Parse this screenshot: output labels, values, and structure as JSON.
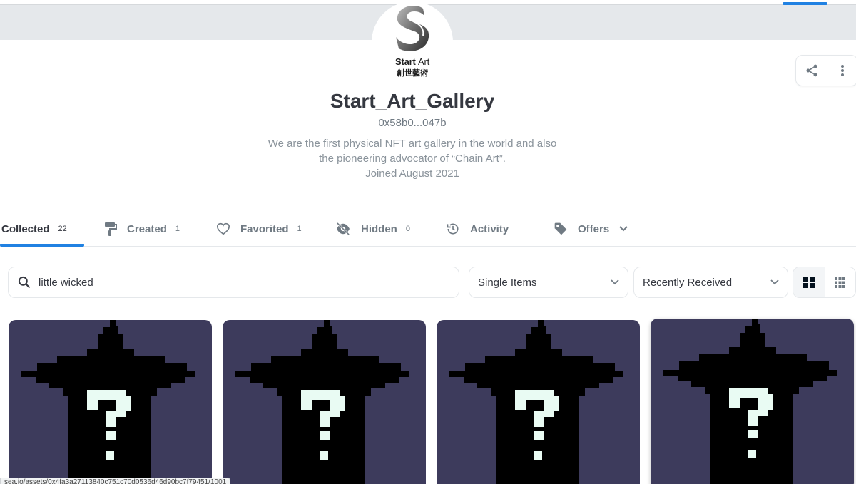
{
  "profile": {
    "logo_text_start": "Start",
    "logo_text_art": "Art",
    "logo_text_cn": "創世藝術",
    "name": "Start_Art_Gallery",
    "wallet": "0x58b0...047b",
    "bio_line1": "We are the first physical NFT art gallery in the world and also",
    "bio_line2": "the pioneering advocator of “Chain Art”.",
    "joined": "Joined August 2021"
  },
  "actions": {
    "share_icon": "share-icon",
    "more_icon": "more-vertical-icon"
  },
  "tabs": [
    {
      "label": "Collected",
      "count": "22",
      "active": true
    },
    {
      "label": "Created",
      "count": "1",
      "icon": "paint-roller-icon"
    },
    {
      "label": "Favorited",
      "count": "1",
      "icon": "heart-icon"
    },
    {
      "label": "Hidden",
      "count": "0",
      "icon": "eye-off-icon"
    },
    {
      "label": "Activity",
      "icon": "history-icon"
    },
    {
      "label": "Offers",
      "icon": "tag-icon"
    }
  ],
  "filters": {
    "search_value": "little wicked",
    "item_type": "Single Items",
    "sort": "Recently Received"
  },
  "cards_count_visible": 4,
  "status_url": "sea.io/assets/0x4fa3a27113840c751c70d0536d46d90bc7f79451/1001",
  "colors": {
    "accent": "#2081e2",
    "card_bg": "#3d3b5c",
    "text": "#353840",
    "muted": "#707a83"
  }
}
